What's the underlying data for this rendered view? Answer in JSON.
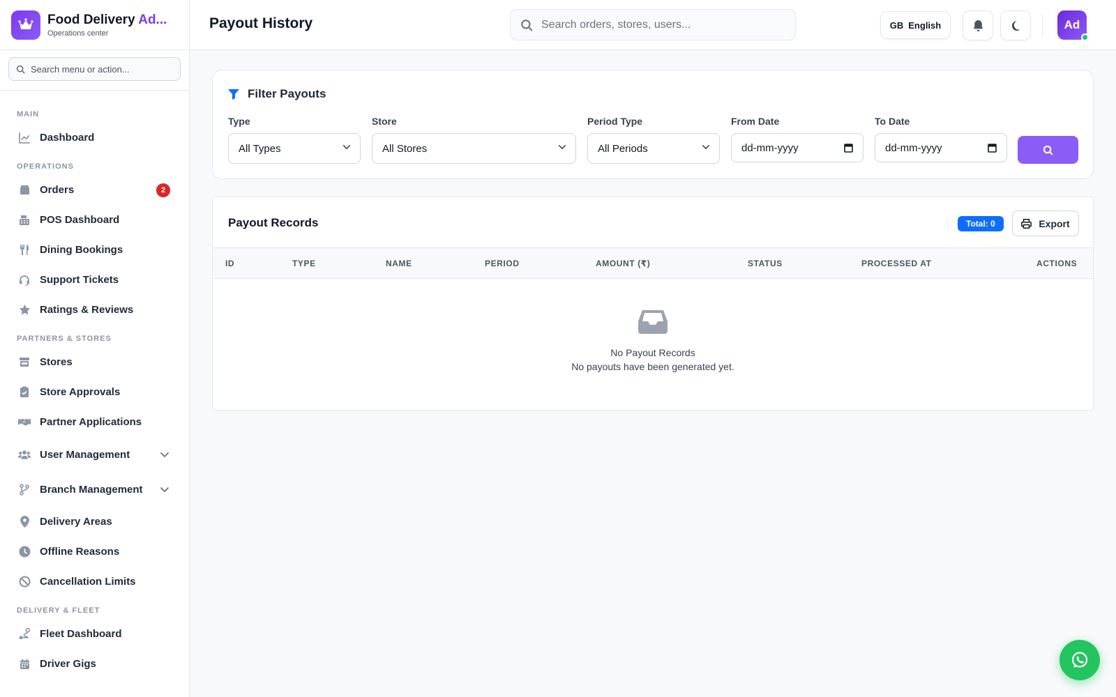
{
  "brand": {
    "title_main": "Food Delivery ",
    "title_accent": "Ad...",
    "subtitle": "Operations center"
  },
  "sidebar": {
    "search_placeholder": "Search menu or action...",
    "sections": {
      "main": "MAIN",
      "operations": "OPERATIONS",
      "partners": "PARTNERS & STORES",
      "delivery": "DELIVERY & FLEET"
    },
    "items": {
      "dashboard": "Dashboard",
      "orders": "Orders",
      "orders_badge": "2",
      "pos": "POS Dashboard",
      "dining": "Dining Bookings",
      "support": "Support Tickets",
      "ratings": "Ratings & Reviews",
      "stores": "Stores",
      "store_approvals": "Store Approvals",
      "partner_apps": "Partner Applications",
      "user_mgmt": "User Management",
      "branch_mgmt": "Branch Management",
      "delivery_areas": "Delivery Areas",
      "offline_reasons": "Offline Reasons",
      "cancel_limits": "Cancellation Limits",
      "fleet": "Fleet Dashboard",
      "driver_gigs": "Driver Gigs"
    }
  },
  "header": {
    "title": "Payout History",
    "search_placeholder": "Search orders, stores, users...",
    "lang_code": "GB",
    "lang_label": "English",
    "avatar": "Ad"
  },
  "filter": {
    "title": "Filter Payouts",
    "type_label": "Type",
    "type_value": "All Types",
    "store_label": "Store",
    "store_value": "All Stores",
    "period_label": "Period Type",
    "period_value": "All Periods",
    "from_label": "From Date",
    "from_value": "dd-mm-yyyy",
    "to_label": "To Date",
    "to_value": "dd-mm-yyyy"
  },
  "records": {
    "title": "Payout Records",
    "total": "Total: 0",
    "export": "Export",
    "columns": [
      "ID",
      "TYPE",
      "NAME",
      "PERIOD",
      "AMOUNT (₹)",
      "STATUS",
      "PROCESSED AT",
      "ACTIONS"
    ],
    "empty_title": "No Payout Records",
    "empty_sub": "No payouts have been generated yet."
  },
  "colors": {
    "accent": "#8b5cf6",
    "primary_blue": "#0d6efd",
    "danger": "#dc2626",
    "whatsapp": "#22c55e"
  }
}
